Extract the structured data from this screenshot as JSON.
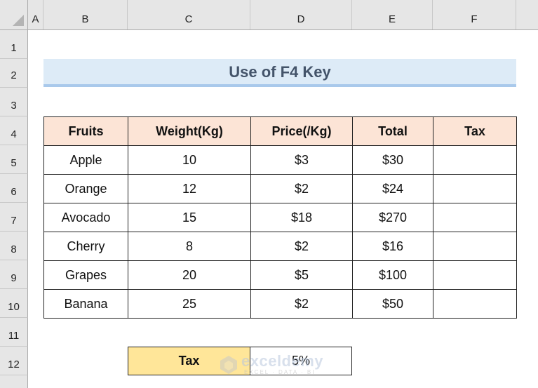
{
  "sheet": {
    "columns": [
      "A",
      "B",
      "C",
      "D",
      "E",
      "F"
    ],
    "rows": [
      "1",
      "2",
      "3",
      "4",
      "5",
      "6",
      "7",
      "8",
      "9",
      "10",
      "11",
      "12"
    ]
  },
  "title": "Use of F4 Key",
  "table": {
    "headers": [
      "Fruits",
      "Weight(Kg)",
      "Price(/Kg)",
      "Total",
      "Tax"
    ],
    "rows": [
      [
        "Apple",
        "10",
        "$3",
        "$30",
        ""
      ],
      [
        "Orange",
        "12",
        "$2",
        "$24",
        ""
      ],
      [
        "Avocado",
        "15",
        "$18",
        "$270",
        ""
      ],
      [
        "Cherry",
        "8",
        "$2",
        "$16",
        ""
      ],
      [
        "Grapes",
        "20",
        "$5",
        "$100",
        ""
      ],
      [
        "Banana",
        "25",
        "$2",
        "$50",
        ""
      ]
    ]
  },
  "tax": {
    "label": "Tax",
    "value": "5%"
  },
  "watermark": {
    "brand": "exceldemy",
    "tagline": "EXCEL · DATA · BI"
  },
  "colors": {
    "title_fill": "#ddebf7",
    "title_text": "#44546a",
    "header_fill": "#fce4d6",
    "tax_label_fill": "#ffe699"
  }
}
